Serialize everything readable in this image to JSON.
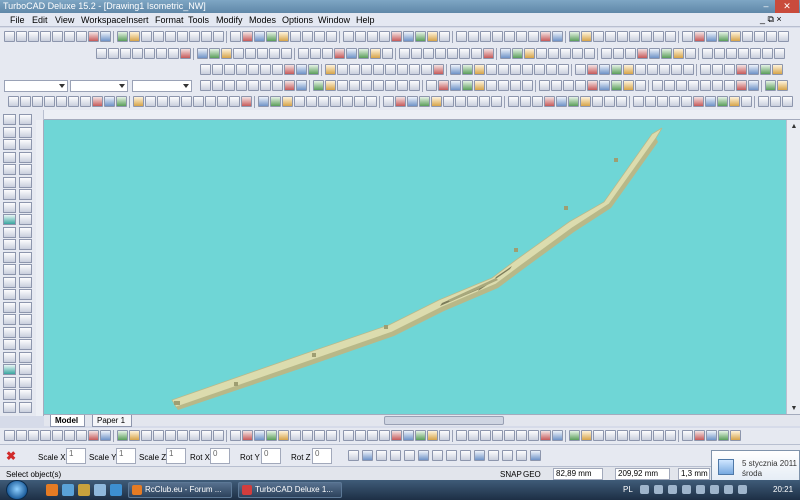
{
  "window": {
    "title": "TurboCAD Deluxe 15.2 - [Drawing1 Isometric_NW]",
    "minimize_glyph": "–",
    "close_glyph": "✕",
    "mdi_controls": "_ ⧉ ×"
  },
  "menu": [
    "File",
    "Edit",
    "View",
    "Workspace",
    "Insert",
    "Format",
    "Tools",
    "Modify",
    "Modes",
    "Options",
    "Window",
    "Help"
  ],
  "tabs": [
    {
      "label": "Model",
      "active": true
    },
    {
      "label": "Paper 1",
      "active": false
    }
  ],
  "properties_bar": {
    "fields": [
      {
        "label": "Scale X",
        "value": "1"
      },
      {
        "label": "Scale Y",
        "value": "1"
      },
      {
        "label": "Scale Z",
        "value": "1"
      },
      {
        "label": "Rot X",
        "value": "0"
      },
      {
        "label": "Rot Y",
        "value": "0"
      },
      {
        "label": "Rot Z",
        "value": "0"
      }
    ]
  },
  "status_bar": {
    "message": "Select object(s)",
    "snap": "SNAP",
    "geo": "GEO",
    "x": "82,89 mm",
    "y": "209,92 mm",
    "z": "1,3 mm"
  },
  "taskbar": {
    "buttons": [
      {
        "label": "RcClub.eu - Forum ..."
      },
      {
        "label": "TurboCAD Deluxe 1..."
      }
    ],
    "language": "PL",
    "time": "20:21"
  },
  "date_popup": {
    "date": "5 stycznia 2011",
    "weekday": "środa"
  },
  "colors": {
    "canvas": "#6fd6d6",
    "model": "#dcdcae",
    "titlebar": "#6d95b6"
  }
}
